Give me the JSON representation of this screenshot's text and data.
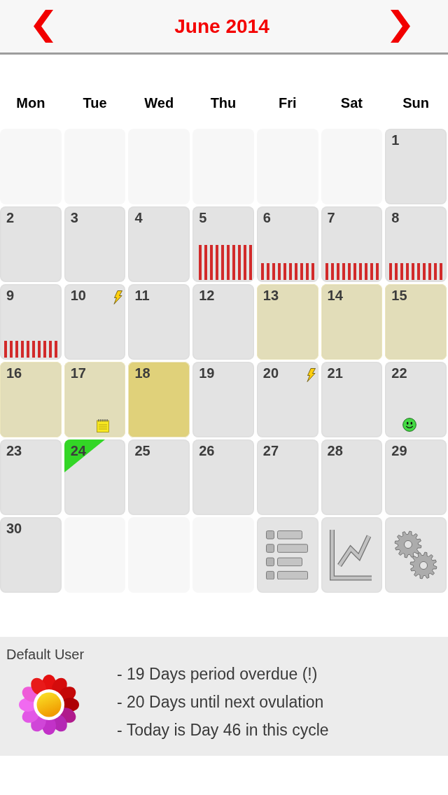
{
  "header": {
    "title": "June 2014"
  },
  "weekdays": [
    "Mon",
    "Tue",
    "Wed",
    "Thu",
    "Fri",
    "Sat",
    "Sun"
  ],
  "weeks": [
    [
      {
        "kind": "blank"
      },
      {
        "kind": "blank"
      },
      {
        "kind": "blank"
      },
      {
        "kind": "blank"
      },
      {
        "kind": "blank"
      },
      {
        "kind": "blank"
      },
      {
        "kind": "day",
        "day": "1",
        "fertile": false,
        "ovulation": false,
        "today": false,
        "period": false
      }
    ],
    [
      {
        "kind": "day",
        "day": "2",
        "fertile": false,
        "ovulation": false,
        "today": false,
        "period": false
      },
      {
        "kind": "day",
        "day": "3",
        "fertile": false,
        "ovulation": false,
        "today": false,
        "period": false
      },
      {
        "kind": "day",
        "day": "4",
        "fertile": false,
        "ovulation": false,
        "today": false,
        "period": false
      },
      {
        "kind": "day",
        "day": "5",
        "fertile": false,
        "ovulation": false,
        "today": false,
        "period": true,
        "heavy_flow": true
      },
      {
        "kind": "day",
        "day": "6",
        "fertile": false,
        "ovulation": false,
        "today": false,
        "period": true,
        "heavy_flow": false
      },
      {
        "kind": "day",
        "day": "7",
        "fertile": false,
        "ovulation": false,
        "today": false,
        "period": true,
        "heavy_flow": false
      },
      {
        "kind": "day",
        "day": "8",
        "fertile": false,
        "ovulation": false,
        "today": false,
        "period": true,
        "heavy_flow": false
      }
    ],
    [
      {
        "kind": "day",
        "day": "9",
        "fertile": false,
        "ovulation": false,
        "today": false,
        "period": true,
        "heavy_flow": false
      },
      {
        "kind": "day",
        "day": "10",
        "fertile": false,
        "ovulation": false,
        "today": false,
        "period": false,
        "markers": [
          {
            "kind": "bolt"
          }
        ]
      },
      {
        "kind": "day",
        "day": "11",
        "fertile": false,
        "ovulation": false,
        "today": false,
        "period": false
      },
      {
        "kind": "day",
        "day": "12",
        "fertile": false,
        "ovulation": false,
        "today": false,
        "period": false
      },
      {
        "kind": "day",
        "day": "13",
        "fertile": true,
        "ovulation": false,
        "today": false,
        "period": false
      },
      {
        "kind": "day",
        "day": "14",
        "fertile": true,
        "ovulation": false,
        "today": false,
        "period": false
      },
      {
        "kind": "day",
        "day": "15",
        "fertile": true,
        "ovulation": false,
        "today": false,
        "period": false
      }
    ],
    [
      {
        "kind": "day",
        "day": "16",
        "fertile": true,
        "ovulation": false,
        "today": false,
        "period": false
      },
      {
        "kind": "day",
        "day": "17",
        "fertile": true,
        "ovulation": false,
        "today": false,
        "period": false,
        "markers": [
          {
            "kind": "notepad"
          }
        ]
      },
      {
        "kind": "day",
        "day": "18",
        "fertile": true,
        "ovulation": true,
        "today": false,
        "period": false
      },
      {
        "kind": "day",
        "day": "19",
        "fertile": false,
        "ovulation": false,
        "today": false,
        "period": false
      },
      {
        "kind": "day",
        "day": "20",
        "fertile": false,
        "ovulation": false,
        "today": false,
        "period": false,
        "markers": [
          {
            "kind": "bolt"
          }
        ]
      },
      {
        "kind": "day",
        "day": "21",
        "fertile": false,
        "ovulation": false,
        "today": false,
        "period": false
      },
      {
        "kind": "day",
        "day": "22",
        "fertile": false,
        "ovulation": false,
        "today": false,
        "period": false,
        "markers": [
          {
            "kind": "smiley"
          }
        ]
      }
    ],
    [
      {
        "kind": "day",
        "day": "23",
        "fertile": false,
        "ovulation": false,
        "today": false,
        "period": false
      },
      {
        "kind": "day",
        "day": "24",
        "fertile": false,
        "ovulation": false,
        "today": true,
        "period": false
      },
      {
        "kind": "day",
        "day": "25",
        "fertile": false,
        "ovulation": false,
        "today": false,
        "period": false
      },
      {
        "kind": "day",
        "day": "26",
        "fertile": false,
        "ovulation": false,
        "today": false,
        "period": false
      },
      {
        "kind": "day",
        "day": "27",
        "fertile": false,
        "ovulation": false,
        "today": false,
        "period": false
      },
      {
        "kind": "day",
        "day": "28",
        "fertile": false,
        "ovulation": false,
        "today": false,
        "period": false
      },
      {
        "kind": "day",
        "day": "29",
        "fertile": false,
        "ovulation": false,
        "today": false,
        "period": false
      }
    ],
    [
      {
        "kind": "day",
        "day": "30",
        "fertile": false,
        "ovulation": false,
        "today": false,
        "period": false
      },
      {
        "kind": "blank"
      },
      {
        "kind": "blank"
      },
      {
        "kind": "blank"
      },
      {
        "kind": "list"
      },
      {
        "kind": "chart"
      },
      {
        "kind": "settings"
      }
    ]
  ],
  "summary": {
    "user": "Default User",
    "lines": [
      "- 19 Days period overdue (!)",
      "- 20 Days until next ovulation",
      "- Today is Day 46 in this cycle"
    ]
  }
}
